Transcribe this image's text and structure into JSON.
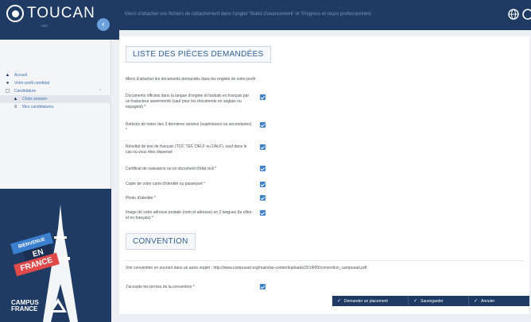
{
  "app": {
    "logo_text": "TOUCAN",
    "logo_small": "HEP",
    "subtitle": "Merci d'attacher vos fichiers de rattachement dans l'onglet 'Statut d'avancement' et 'Progress et reçus professionnels'"
  },
  "sidebar": {
    "items": [
      {
        "label": "Accueil"
      },
      {
        "label": "Votre profil candidat"
      },
      {
        "label": "Candidature"
      },
      {
        "label": "Choix session"
      },
      {
        "label": "Mes candidatures"
      }
    ],
    "promo": {
      "bienvenue": "BIENVENUE",
      "en": "EN",
      "france": "FRANCE",
      "campus_line1": "CAMPUS",
      "campus_line2": "FRANCE"
    }
  },
  "main": {
    "pieces_title": "LISTE DES PIÈCES DEMANDÉES",
    "intro": "Merci d'attacher les documents demandés dans les onglets de votre profil",
    "documents": [
      {
        "label": "Documents officiels dans la langue d'origine et traduits en français par un traducteur assermenté (sauf pour les documents en anglais ou espagnol) *",
        "checked": true
      },
      {
        "label": "Relevés de notes des 3 dernières années (supérieures ou secondaires) *",
        "checked": true
      },
      {
        "label": "Résultat de test de français (TCF, TEF, DELF ou DALF), sauf dans le cas où vous êtes dispensé",
        "checked": true
      },
      {
        "label": "Certificat de naissance ou un document d'état civil *",
        "checked": true
      },
      {
        "label": "Copie de votre carte d'identité ou passeport *",
        "checked": true
      },
      {
        "label": "Photo d'identité *",
        "checked": true
      },
      {
        "label": "Image de votre adresse postale (nom et adresse) en 2 langues (la vôtre et en français) *",
        "checked": true
      }
    ],
    "convention_title": "CONVENTION",
    "convention_text": "Voir convention en ouvrant dans un autre onglet : http://www.campusart.org/main/wp-content/uploads/2014/09/convention_campusart.pdf",
    "accept_label": "J'accepte les termes de la convention *",
    "accept_checked": true,
    "buttons": {
      "placement": "Demander un placement",
      "save": "Sauvegarder",
      "cancel": "Annuler"
    }
  },
  "colors": {
    "navy": "#1f3b63",
    "accent": "#3f7fd1",
    "link": "#3f6fb0",
    "red": "#e04a4a"
  }
}
